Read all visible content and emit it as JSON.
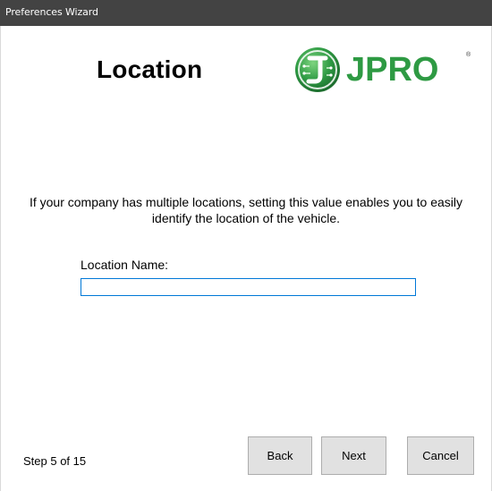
{
  "window": {
    "title": "Preferences Wizard"
  },
  "page": {
    "title": "Location",
    "description": "If your company has multiple locations, setting this value enables you to easily identify the location of the vehicle."
  },
  "logo": {
    "text": "JPRO",
    "registered_mark": "®",
    "brand_color": "#2e9a43",
    "icon": "jpro-circuit-logo-icon"
  },
  "form": {
    "location_name_label": "Location Name:",
    "location_name_value": ""
  },
  "footer": {
    "step_text": "Step 5 of 15",
    "back_label": "Back",
    "next_label": "Next",
    "cancel_label": "Cancel"
  },
  "colors": {
    "titlebar": "#434343",
    "input_focus_border": "#0078d7",
    "button_face": "#e1e1e1"
  }
}
